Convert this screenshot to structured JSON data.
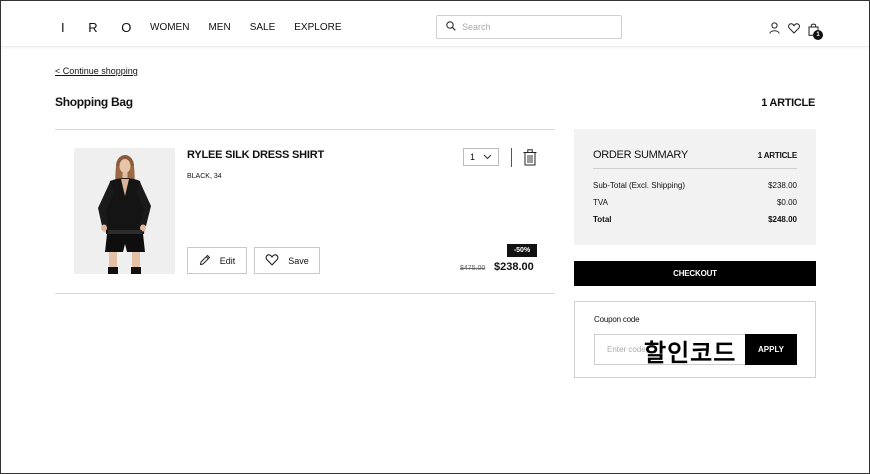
{
  "header": {
    "logo": "I R O",
    "nav": [
      "WOMEN",
      "MEN",
      "SALE",
      "EXPLORE"
    ],
    "search_placeholder": "Search",
    "icons": [
      "user-icon",
      "heart-icon",
      "shopping-bag-icon"
    ],
    "bag_count": "1"
  },
  "page": {
    "continue_link": "< Continue shopping",
    "title": "Shopping Bag",
    "article_count": "1 ARTICLE"
  },
  "item": {
    "name": "RYLEE SILK DRESS SHIRT",
    "variant": "BLACK, 34",
    "quantity": "1",
    "edit_label": "Edit",
    "save_label": "Save",
    "discount_badge": "-50%",
    "original_price": "$475.00",
    "price": "$238.00"
  },
  "summary": {
    "title": "ORDER SUMMARY",
    "count": "1 ARTICLE",
    "rows": [
      {
        "label": "Sub-Total (Excl. Shipping)",
        "value": "$238.00"
      },
      {
        "label": "TVA",
        "value": "$0.00"
      },
      {
        "label": "Total",
        "value": "$248.00"
      }
    ]
  },
  "checkout_label": "CHECKOUT",
  "coupon": {
    "label": "Coupon code",
    "placeholder": "Enter code",
    "apply_label": "APPLY",
    "overlay_text": "할인코드"
  }
}
